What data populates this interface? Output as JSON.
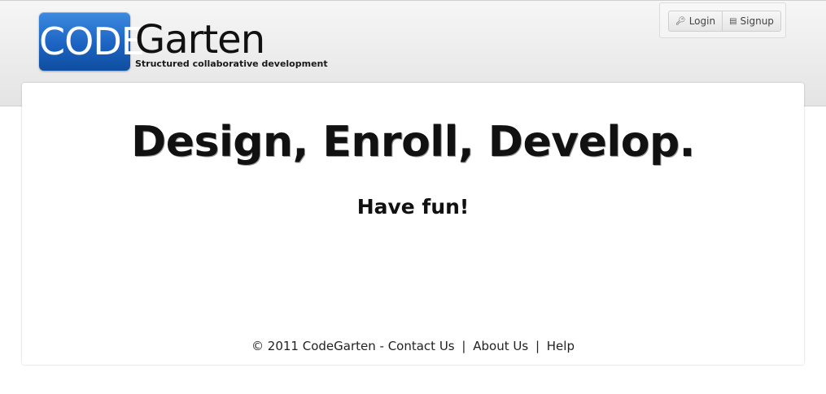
{
  "header": {
    "logo": {
      "badge_text": "CODE",
      "word_text": "Garten",
      "tagline": "Structured collaborative development",
      "colors": {
        "badge_top": "#3d8be0",
        "badge_bottom": "#0f4e9f"
      }
    },
    "auth": {
      "login_label": "Login",
      "signup_label": "Signup",
      "login_icon": "key-icon",
      "signup_icon": "signup-card-icon"
    }
  },
  "hero": {
    "title": "Design, Enroll, Develop.",
    "subtitle": "Have fun!"
  },
  "footer": {
    "copyright": "© 2011 CodeGarten -",
    "links": {
      "contact": "Contact Us",
      "about": "About Us",
      "help": "Help"
    },
    "separator": "|"
  }
}
